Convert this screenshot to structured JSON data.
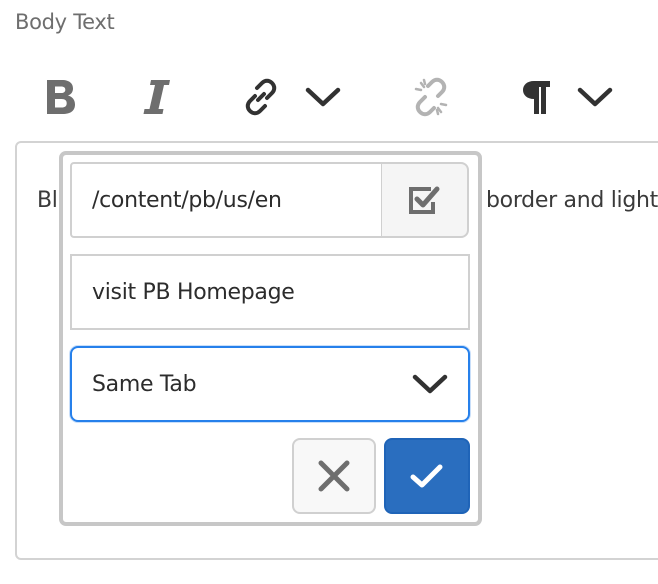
{
  "field_label": "Body Text",
  "toolbar": {
    "items": [
      {
        "name": "bold",
        "icon": "bold-icon"
      },
      {
        "name": "italic",
        "icon": "italic-icon"
      },
      {
        "name": "link",
        "icon": "link-icon"
      },
      {
        "name": "link-dropdown",
        "icon": "chevron-down-icon"
      },
      {
        "name": "unlink",
        "icon": "unlink-icon",
        "disabled": true
      },
      {
        "name": "paragraph",
        "icon": "paragraph-icon"
      },
      {
        "name": "paragraph-dropdown",
        "icon": "chevron-down-icon"
      }
    ]
  },
  "editor": {
    "text_left": "Bl",
    "text_right": "border and light"
  },
  "link_dialog": {
    "path_value": "/content/pb/us/en",
    "browse_icon": "checkbox-checked-icon",
    "alt_text_value": "visit PB Homepage",
    "target_selected": "Same Tab",
    "cancel_icon": "close-icon",
    "apply_icon": "checkmark-icon"
  },
  "colors": {
    "accent": "#2a6ebf",
    "focus_border": "#2680eb",
    "icon_gray": "#6e6e6e",
    "icon_dark": "#323232",
    "disabled": "#b3b3b3"
  }
}
